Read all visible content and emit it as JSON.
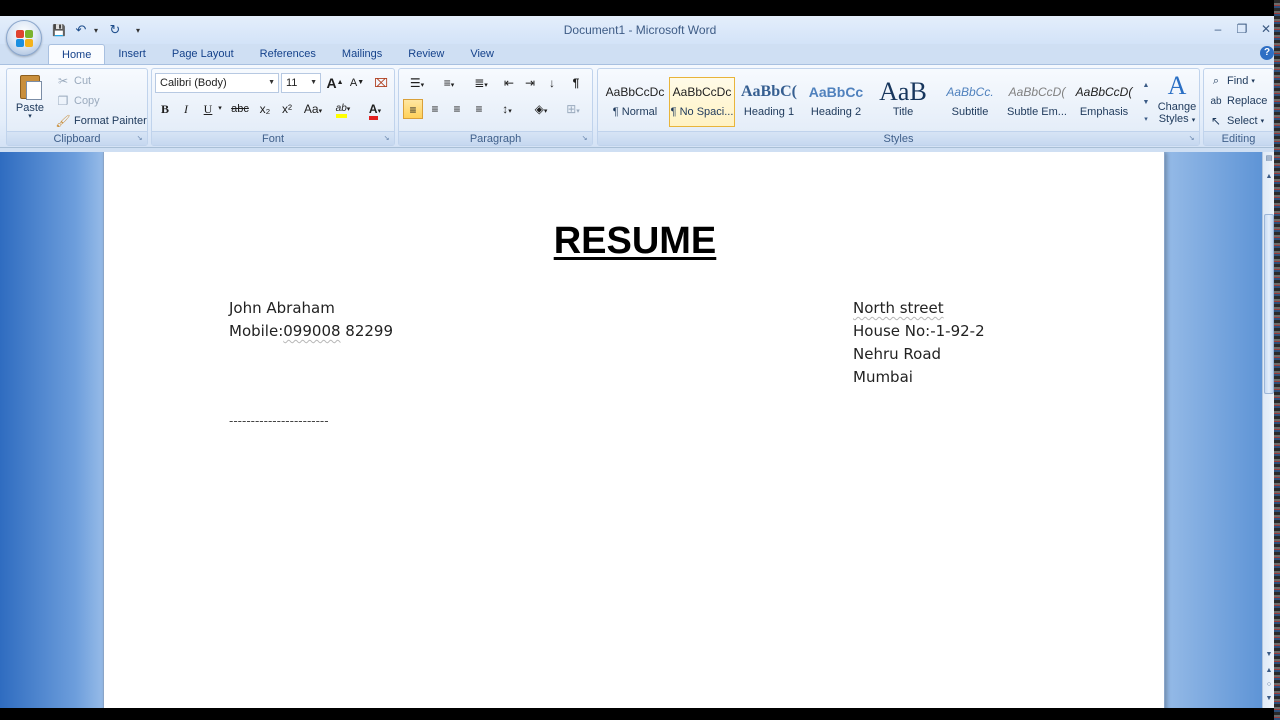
{
  "window": {
    "title": "Document1 - Microsoft Word",
    "minimize": "–",
    "restore": "❐",
    "close": "✕"
  },
  "quick_access": {
    "save": "💾",
    "undo": "↶",
    "redo": "↻",
    "customize": "▾"
  },
  "tabs": [
    "Home",
    "Insert",
    "Page Layout",
    "References",
    "Mailings",
    "Review",
    "View"
  ],
  "active_tab": "Home",
  "help": "?",
  "clipboard": {
    "label": "Clipboard",
    "paste": "Paste",
    "cut": "Cut",
    "copy": "Copy",
    "format_painter": "Format Painter"
  },
  "font": {
    "label": "Font",
    "family": "Calibri (Body)",
    "size": "11",
    "grow": "A",
    "shrink": "A",
    "clear": "⌧",
    "bold": "B",
    "italic": "I",
    "underline": "U",
    "strike": "abc",
    "subscript": "x₂",
    "superscript": "x²",
    "change_case": "Aa",
    "highlight": "ab",
    "font_color": "A"
  },
  "paragraph": {
    "label": "Paragraph",
    "bullets": "☰",
    "numbering": "≡",
    "multilevel": "≣",
    "decrease_indent": "⇤",
    "increase_indent": "⇥",
    "sort": "↓",
    "show_marks": "¶",
    "align_left": "≡",
    "center": "≡",
    "align_right": "≡",
    "justify": "≡",
    "line_spacing": "↕",
    "shading": "◈",
    "borders": "⊞"
  },
  "styles": {
    "label": "Styles",
    "items": [
      {
        "sample": "AaBbCcDc",
        "name": "¶ Normal"
      },
      {
        "sample": "AaBbCcDc",
        "name": "¶ No Spaci..."
      },
      {
        "sample": "AaBbC(",
        "name": "Heading 1"
      },
      {
        "sample": "AaBbCc",
        "name": "Heading 2"
      },
      {
        "sample": "AaB",
        "name": "Title"
      },
      {
        "sample": "AaBbCc.",
        "name": "Subtitle"
      },
      {
        "sample": "AaBbCcD(",
        "name": "Subtle Em..."
      },
      {
        "sample": "AaBbCcD(",
        "name": "Emphasis"
      }
    ],
    "change_styles_line1": "Change",
    "change_styles_line2": "Styles"
  },
  "editing": {
    "label": "Editing",
    "find": "Find",
    "replace": "Replace",
    "select": "Select"
  },
  "document": {
    "title": "RESUME",
    "left_lines": [
      "John Abraham",
      "Mobile:",
      "099008",
      " 82299"
    ],
    "right_lines": [
      "North street",
      "House No:-1-92-2",
      "Nehru Road",
      "Mumbai"
    ],
    "separator": "-----------------------"
  },
  "colors": {
    "ribbon_text": "#15428b",
    "selected_style_border": "#e8b43a",
    "font_color_red": "#e02020",
    "highlight_yellow": "#ffff00"
  }
}
